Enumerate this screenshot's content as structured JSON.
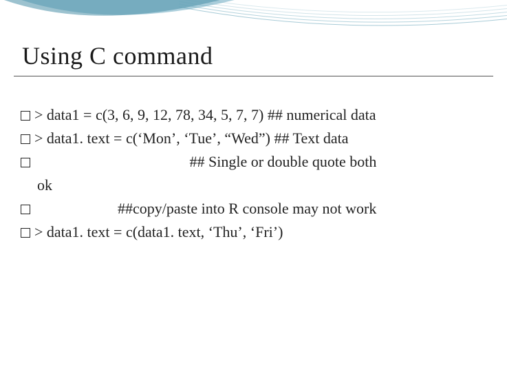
{
  "title": "Using C command",
  "lines": [
    "> data1 = c(3, 6, 9, 12, 78, 34, 5, 7, 7)   ## numerical data",
    "> data1. text = c(‘Mon’, ‘Tue’, “Wed”)  ## Text data",
    "                                         ## Single or double quote both",
    "ok",
    "                      ##copy/paste into R console may not work",
    "> data1. text = c(data1. text, ‘Thu’, ‘Fri’)"
  ]
}
